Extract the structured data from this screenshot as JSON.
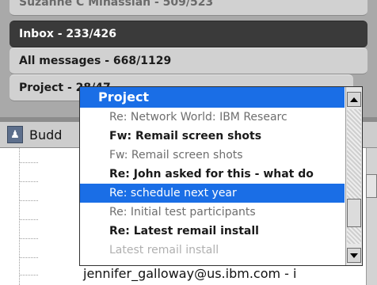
{
  "folders": [
    {
      "label": "Suzanne C Minassian - 509/523"
    },
    {
      "label": "Inbox - 233/426"
    },
    {
      "label": "All messages - 668/1129"
    },
    {
      "label": "Project - 28/47"
    }
  ],
  "buddy_panel": {
    "label": "Budd",
    "icon": "person-icon"
  },
  "email_text": "jennifer_galloway@us.ibm.com - i",
  "dropdown": {
    "title": "Project",
    "items": [
      {
        "label": "Re: Network World: IBM Researc",
        "unread": false,
        "selected": false
      },
      {
        "label": "Fw: Remail screen shots",
        "unread": true,
        "selected": false
      },
      {
        "label": "Fw: Remail screen shots",
        "unread": false,
        "selected": false
      },
      {
        "label": "Re: John asked for this - what do",
        "unread": true,
        "selected": false
      },
      {
        "label": "Re: schedule next year",
        "unread": false,
        "selected": true
      },
      {
        "label": "Re: Initial test participants",
        "unread": false,
        "selected": false
      },
      {
        "label": "Re: Latest remail install",
        "unread": true,
        "selected": false
      },
      {
        "label": "Latest remail install",
        "unread": false,
        "selected": false
      }
    ]
  },
  "colors": {
    "selection": "#1a6ee6",
    "inbox_tab": "#3a3a3a"
  }
}
